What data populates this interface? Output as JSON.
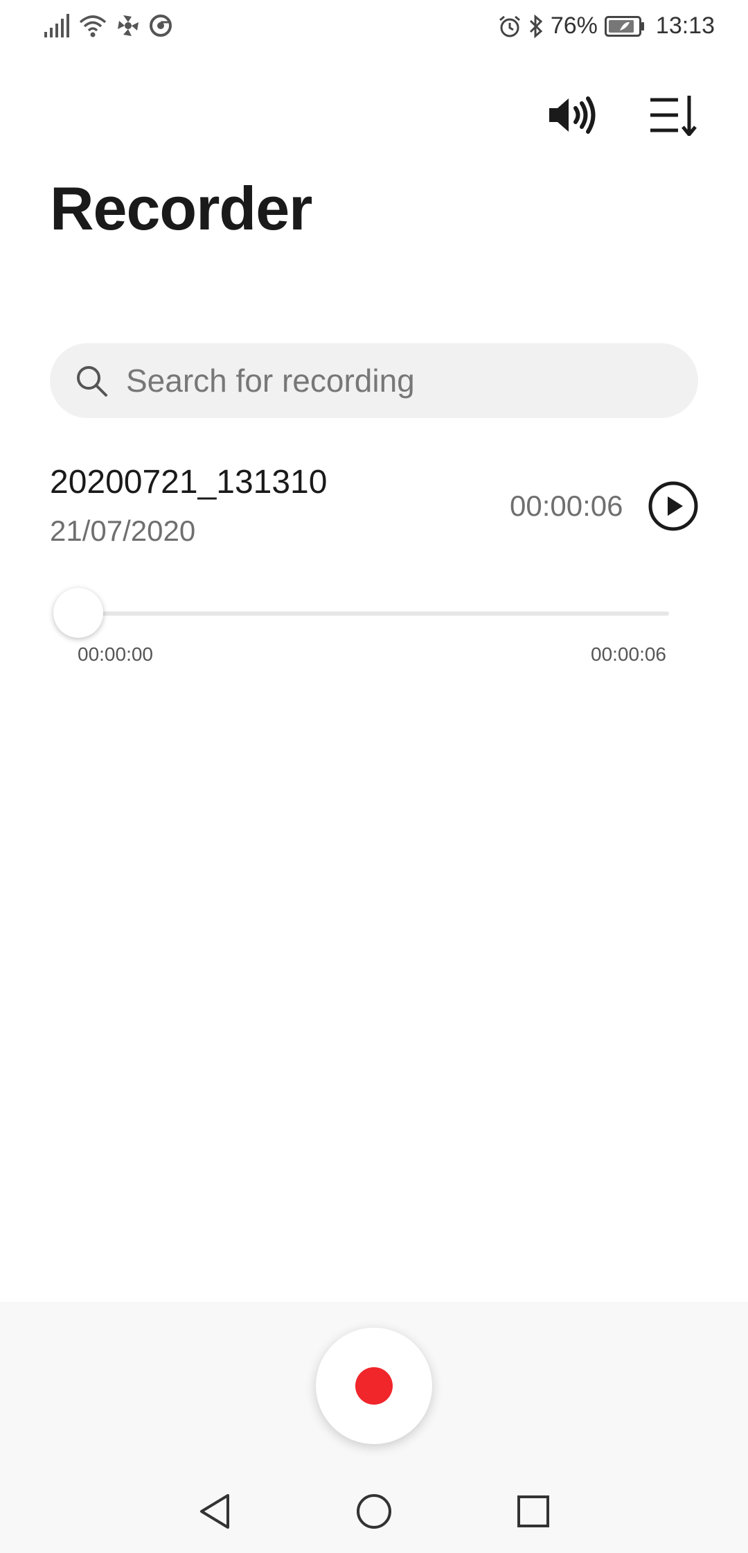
{
  "status_bar": {
    "battery": "76%",
    "time": "13:13",
    "left_icons": [
      "signal-icon",
      "wifi-icon",
      "fan-icon",
      "chrome-icon"
    ],
    "right_icons": [
      "alarm-icon",
      "bluetooth-icon",
      "battery-icon"
    ]
  },
  "toolbar": {
    "icons": [
      "speaker-icon",
      "sort-icon"
    ]
  },
  "header": {
    "title": "Recorder"
  },
  "search": {
    "placeholder": "Search for recording"
  },
  "recordings": [
    {
      "name": "20200721_131310",
      "date": "21/07/2020",
      "duration": "00:00:06",
      "playback": {
        "current": "00:00:00",
        "total": "00:00:06",
        "progress": 0
      }
    }
  ],
  "colors": {
    "record_accent": "#f0262a",
    "search_bg": "#f1f1f1",
    "bottom_panel_bg": "#f8f8f8"
  },
  "nav_bar": {
    "icons": [
      "back-icon",
      "home-icon",
      "recents-icon"
    ]
  }
}
